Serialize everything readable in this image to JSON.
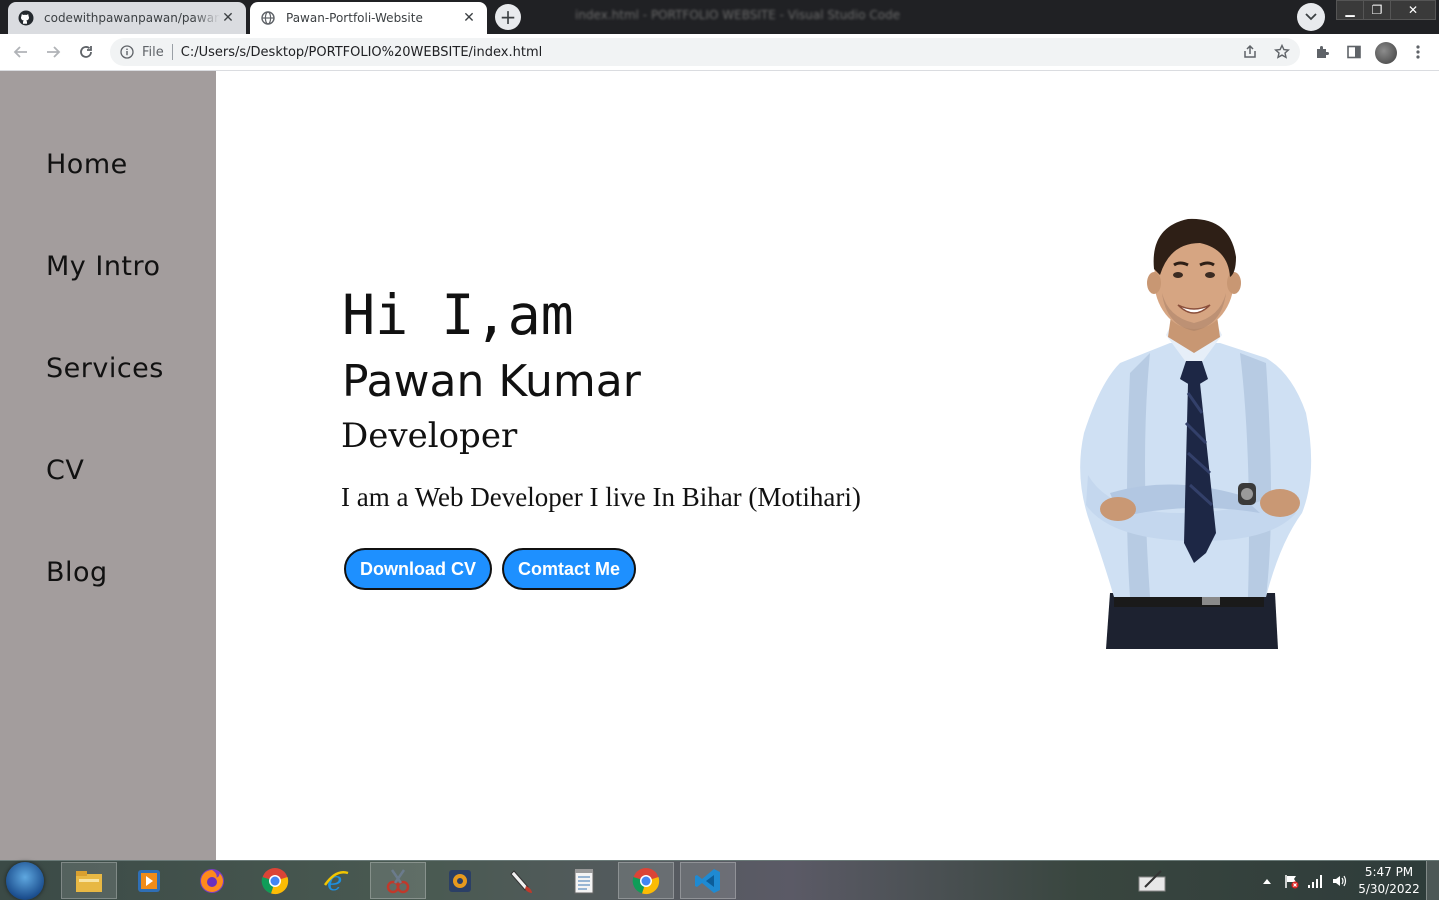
{
  "browser": {
    "tabs": [
      {
        "title": "codewithpawanpawan/pawan-portfolio-website",
        "icon": "github-icon",
        "active": false
      },
      {
        "title": "Pawan-Portfoli-Website",
        "icon": "globe-icon",
        "active": true
      }
    ],
    "new_tab_label": "+",
    "address": {
      "scheme_label": "File",
      "url": "C:/Users/s/Desktop/PORTFOLIO%20WEBSITE/index.html"
    }
  },
  "sidebar": {
    "items": [
      {
        "label": "Home"
      },
      {
        "label": "My Intro"
      },
      {
        "label": "Services"
      },
      {
        "label": "CV"
      },
      {
        "label": "Blog"
      }
    ]
  },
  "hero": {
    "greeting": "Hi I,am",
    "name": "Pawan Kumar",
    "role": "Developer",
    "bio": "I am a Web Developer I live In Bihar (Motihari)",
    "buttons": {
      "download": "Download CV",
      "contact": "Comtact Me"
    }
  },
  "taskbar": {
    "apps": [
      "file-explorer-icon",
      "media-player-icon",
      "firefox-icon",
      "chrome-icon",
      "internet-explorer-icon",
      "snipping-tool-icon",
      "media-center-icon",
      "paint-brush-icon",
      "notepad-icon",
      "chrome-icon",
      "vscode-icon"
    ],
    "clock": {
      "time": "5:47 PM",
      "date": "5/30/2022"
    }
  },
  "colors": {
    "sidebar_bg": "#a39d9d",
    "button_bg": "#1e90ff",
    "tab_strip": "#202124"
  }
}
